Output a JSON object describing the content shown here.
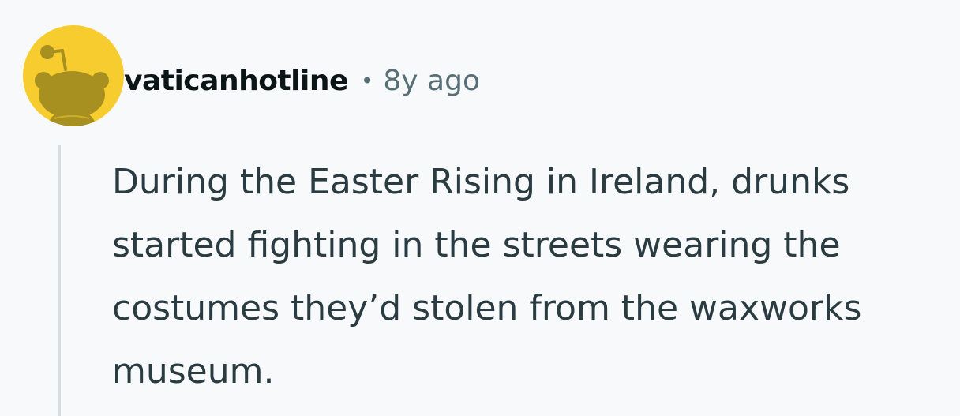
{
  "comment": {
    "author": "vaticanhotline",
    "separator": "•",
    "age": "8y ago",
    "body": "During the Easter Rising in Ireland, drunks started fighting in the streets wearing the costumes they’d stolen from the waxworks museum."
  },
  "colors": {
    "background": "#f7f9fa",
    "avatar_background": "#f7cc2f",
    "avatar_snoo": "#a89020",
    "username": "#0b1416",
    "meta_text": "#576f76",
    "body_text": "#2a3c42",
    "thread_line": "#d7dde2"
  },
  "icons": {
    "avatar": "snoo-avatar-icon"
  }
}
